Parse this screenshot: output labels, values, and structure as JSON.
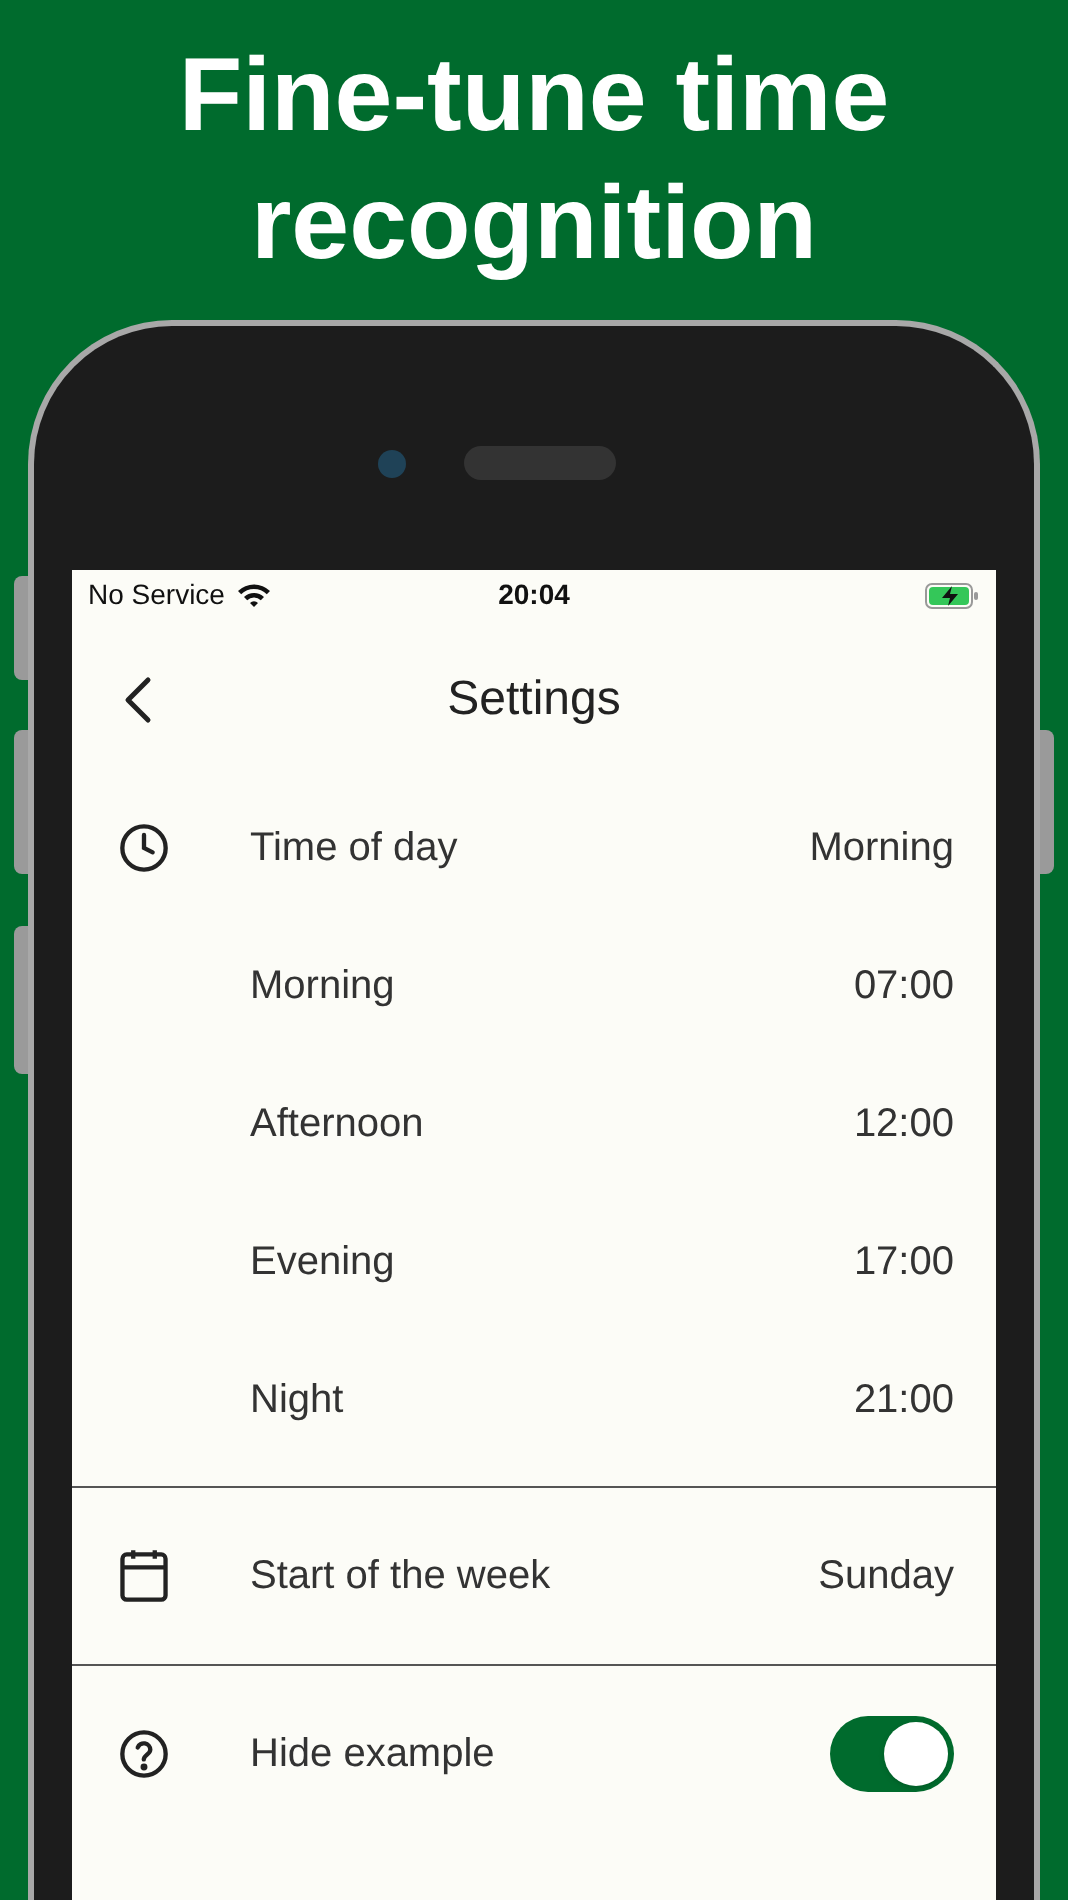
{
  "headline": "Fine-tune time recognition",
  "status_bar": {
    "carrier": "No Service",
    "time": "20:04",
    "charging": true
  },
  "nav": {
    "title": "Settings"
  },
  "time_of_day": {
    "label": "Time of day",
    "value": "Morning",
    "rows": [
      {
        "label": "Morning",
        "value": "07:00"
      },
      {
        "label": "Afternoon",
        "value": "12:00"
      },
      {
        "label": "Evening",
        "value": "17:00"
      },
      {
        "label": "Night",
        "value": "21:00"
      }
    ]
  },
  "week": {
    "label": "Start of the week",
    "value": "Sunday"
  },
  "hide_example": {
    "label": "Hide example",
    "on": true
  }
}
